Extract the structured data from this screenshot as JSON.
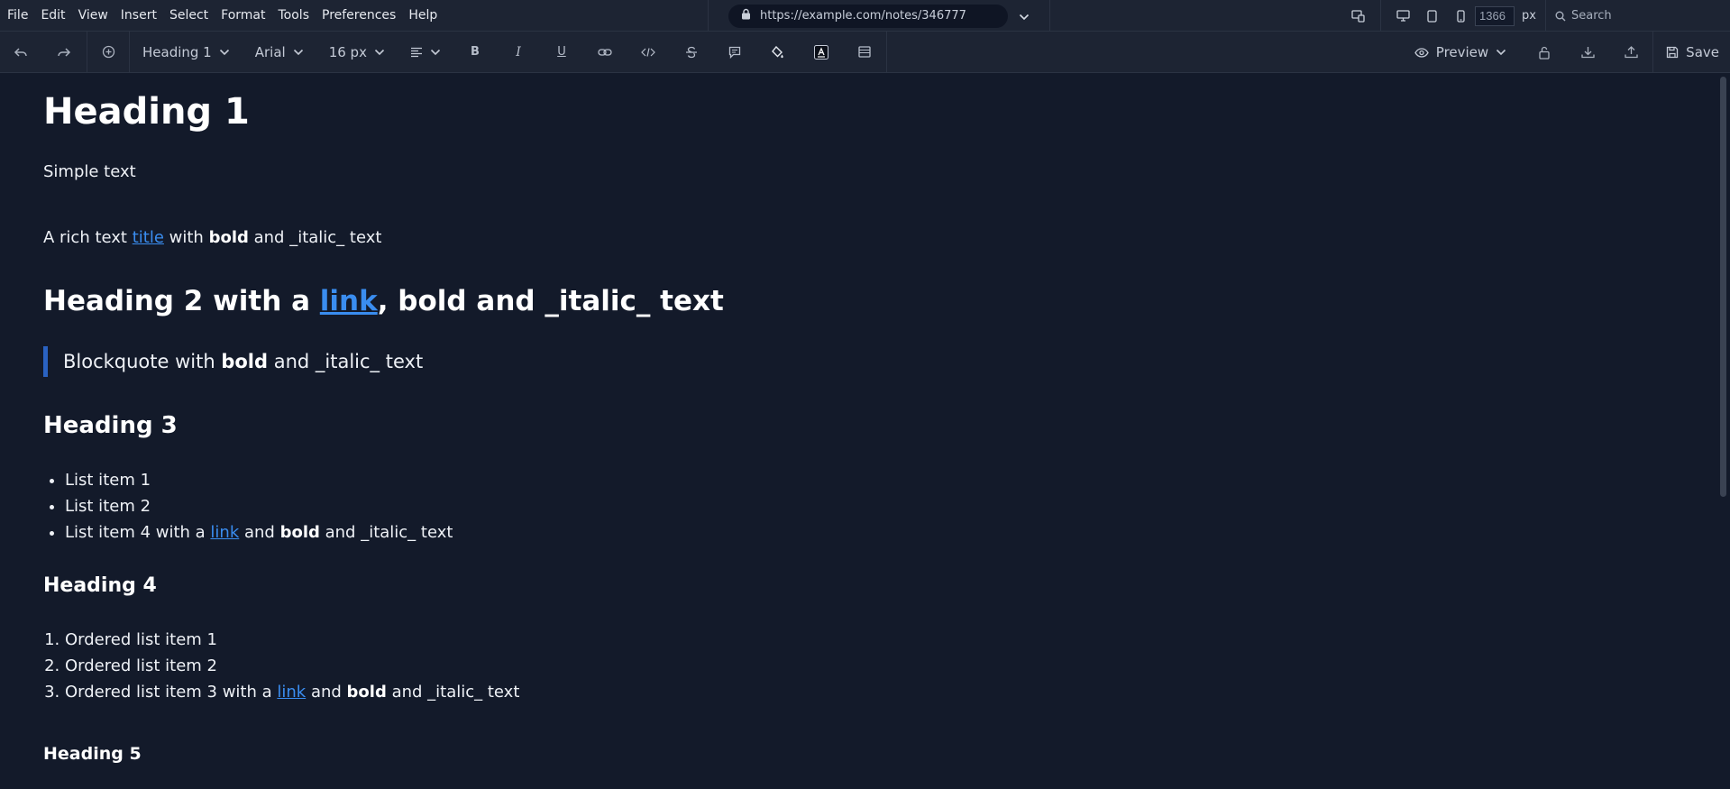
{
  "menu": [
    "File",
    "Edit",
    "View",
    "Insert",
    "Select",
    "Format",
    "Tools",
    "Preferences",
    "Help"
  ],
  "address": {
    "url": "https://example.com/notes/346777"
  },
  "viewport": {
    "width_value": "1366",
    "unit": "px"
  },
  "search": {
    "placeholder": "Search"
  },
  "toolbar": {
    "block_style": "Heading 1",
    "font_family": "Arial",
    "font_size": "16 px",
    "preview_label": "Preview",
    "save_label": "Save",
    "bold_glyph": "B",
    "italic_glyph": "I",
    "underline_glyph": "U"
  },
  "doc": {
    "h1": "Heading 1",
    "simple": "Simple text",
    "rich": {
      "pre": "A rich text ",
      "link": "title",
      "mid1": " with ",
      "bold": "bold",
      "mid2": " and ",
      "post": "_italic_ text"
    },
    "h2": {
      "pre": "Heading 2 with a ",
      "link": "link",
      "mid1": ", ",
      "bold": "bold",
      "post": " and _italic_ text"
    },
    "blockquote": {
      "pre": "Blockquote with ",
      "bold": "bold",
      "post": " and _italic_ text"
    },
    "h3": "Heading 3",
    "ul": {
      "item1": "List item 1",
      "item2": "List item 2",
      "item3": {
        "pre": "List item 4 with a ",
        "link": "link",
        "mid": " and ",
        "bold": "bold",
        "post": " and _italic_ text"
      }
    },
    "h4": "Heading 4",
    "ol": {
      "item1": "Ordered list item 1",
      "item2": "Ordered list item 2",
      "item3": {
        "pre": "Ordered list item 3 with a ",
        "link": "link",
        "mid": " and ",
        "bold": "bold",
        "post": " and _italic_ text"
      }
    },
    "h5": "Heading 5"
  },
  "colors": {
    "background": "#131a2a",
    "bar": "#1d2433",
    "link": "#3a8df0",
    "quote_bar": "#2a62c2"
  }
}
